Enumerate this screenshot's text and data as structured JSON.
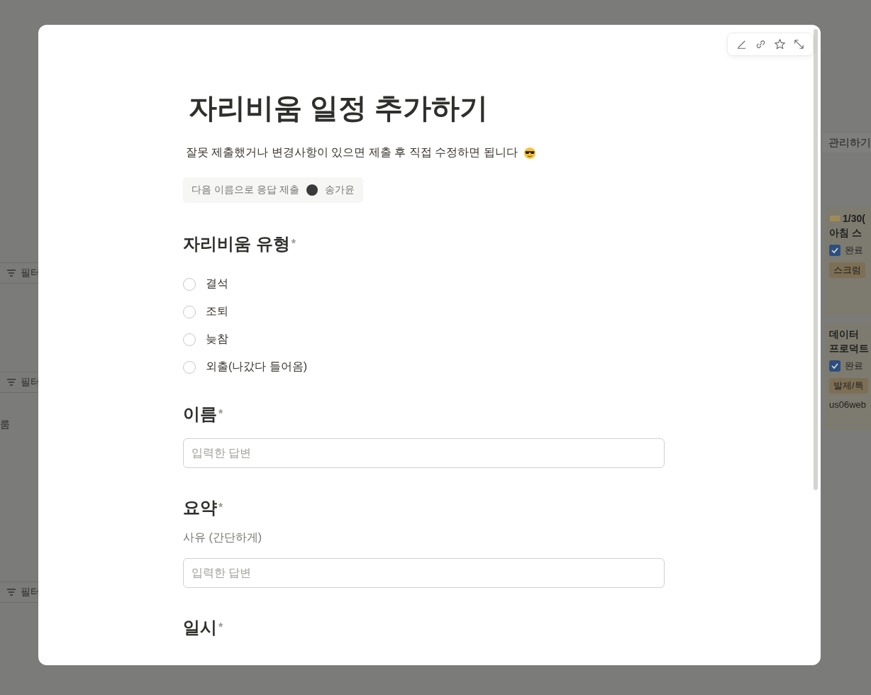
{
  "background_page": {
    "filter_buttons": [
      "필터",
      "필터",
      "필터"
    ],
    "side_text": "룸",
    "manage_button": "관리하기",
    "cards": [
      {
        "title_lines": [
          "1/30(",
          "아침 스"
        ],
        "has_icon": true,
        "done_label": "완료",
        "checked": true,
        "tag": "스크럼"
      },
      {
        "title_lines": [
          "데이터",
          "프로덕트"
        ],
        "has_icon": false,
        "done_label": "완료",
        "checked": true,
        "tag": "발제/특",
        "link": "us06web"
      }
    ]
  },
  "form": {
    "title": "자리비움 일정 추가하기",
    "description": "잘못 제출했거나 변경사항이 있으면 제출 후 직접 수정하면 됩니다",
    "respondent": {
      "label": "다음 이름으로 응답 제출",
      "name": "송가윤"
    },
    "questions": [
      {
        "kind": "choice",
        "title": "자리비움 유형",
        "required_mark": "*",
        "options": [
          {
            "label": "결석",
            "selected": false
          },
          {
            "label": "조퇴",
            "selected": false
          },
          {
            "label": "늦참",
            "selected": false
          },
          {
            "label": "외출(나갔다 들어옴)",
            "selected": false
          }
        ]
      },
      {
        "kind": "text",
        "title": "이름",
        "required_mark": "*",
        "placeholder": "입력한 답변"
      },
      {
        "kind": "text",
        "title": "요약",
        "required_mark": "*",
        "description": "사유 (간단하게)",
        "placeholder": "입력한 답변"
      },
      {
        "kind": "date",
        "title": "일시",
        "required_mark": "*"
      }
    ]
  }
}
